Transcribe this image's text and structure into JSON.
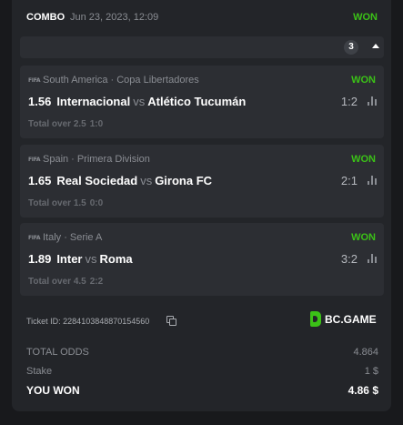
{
  "header": {
    "type_label": "COMBO",
    "date": "Jun 23, 2023, 12:09",
    "status": "WON",
    "selection_count": "3",
    "status_color": "#3bc117"
  },
  "legs": [
    {
      "region": "South America",
      "league": "Copa Libertadores",
      "status": "WON",
      "odds": "1.56",
      "home": "Internacional",
      "vs": "vs",
      "away": "Atlético Tucumán",
      "score": "1:2",
      "market": "Total over 2.5",
      "market_score": "1:0"
    },
    {
      "region": "Spain",
      "league": "Primera Division",
      "status": "WON",
      "odds": "1.65",
      "home": "Real Sociedad",
      "vs": "vs",
      "away": "Girona FC",
      "score": "2:1",
      "market": "Total over 1.5",
      "market_score": "0:0"
    },
    {
      "region": "Italy",
      "league": "Serie A",
      "status": "WON",
      "odds": "1.89",
      "home": "Inter",
      "vs": "vs",
      "away": "Roma",
      "score": "3:2",
      "market": "Total over 4.5",
      "market_score": "2:2"
    }
  ],
  "icons": {
    "sport": "fifa-icon",
    "stats": "bar-chart-icon",
    "copy": "copy-icon",
    "collapse": "caret-up-icon"
  },
  "sport_icon_text": "FIFA",
  "ticket": {
    "label": "Ticket ID: 2284103848870154560"
  },
  "brand": {
    "name": "BC.GAME"
  },
  "summary": {
    "total_odds_label": "TOTAL ODDS",
    "total_odds": "4.864",
    "stake_label": "Stake",
    "stake": "1 $",
    "won_label": "YOU WON",
    "won": "4.86 $"
  }
}
